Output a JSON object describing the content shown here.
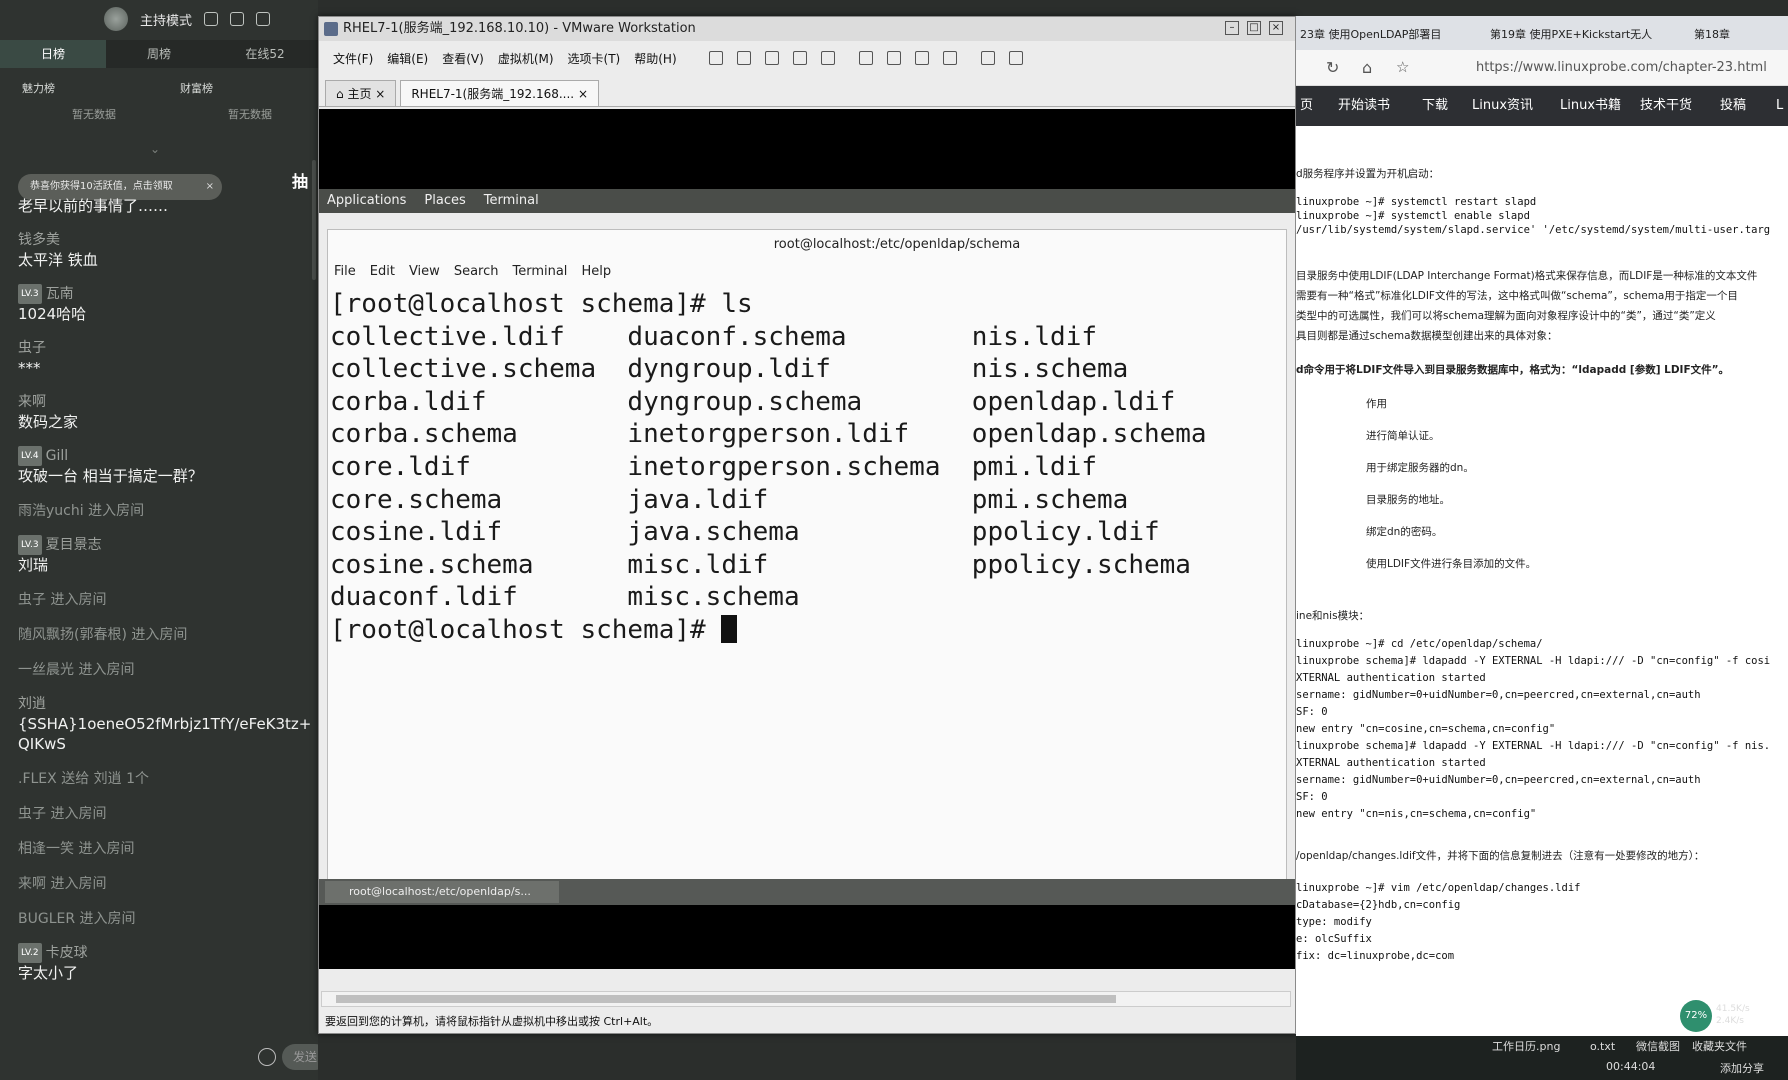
{
  "left_panel": {
    "mode_label": "主持模式",
    "rank_tabs": [
      "日榜",
      "周榜",
      "在线52"
    ],
    "charm_rank": "魅力榜",
    "wealth_rank": "财富榜",
    "charm_empty": "暂无数据",
    "wealth_empty": "暂无数据",
    "toast": "恭喜你获得10活跃值，点击领取",
    "peek_text": "抽",
    "chat": [
      {
        "user": "",
        "text": "老早以前的事情了……"
      },
      {
        "user": "钱多美",
        "text": "太平洋 铁血"
      },
      {
        "lv": "LV.3",
        "user": "瓦南",
        "text": "1024哈哈"
      },
      {
        "user": "虫子",
        "text": "***"
      },
      {
        "user": "来啊",
        "text": "数码之家"
      },
      {
        "lv": "LV.4",
        "user": "Gill",
        "text": "攻破一台 相当于搞定一群？"
      },
      {
        "sys": "雨浩yuchi 进入房间"
      },
      {
        "lv": "LV.3",
        "user": "夏目景志",
        "text": "刘瑞"
      },
      {
        "sys": "虫子 进入房间"
      },
      {
        "sys": "随风飘扬(郭春根) 进入房间"
      },
      {
        "sys": "一丝晨光 进入房间"
      },
      {
        "user": "刘逍",
        "text": "{SSHA}1oeneO52fMrbjz1TfY/eFeK3tz+QIKwS"
      },
      {
        "sys": ".FLEX 送给 刘逍 1个"
      },
      {
        "sys": "虫子 进入房间"
      },
      {
        "sys": "相逢一笑 进入房间"
      },
      {
        "sys": "来啊 进入房间"
      },
      {
        "sys": "BUGLER 进入房间"
      },
      {
        "lv": "LV.2",
        "user": "卡皮球",
        "text": "字太小了"
      }
    ],
    "send_label": "发送"
  },
  "vmware": {
    "title": "RHEL7-1(服务端_192.168.10.10) - VMware Workstation",
    "menu": [
      "文件(F)",
      "编辑(E)",
      "查看(V)",
      "虚拟机(M)",
      "选项卡(T)",
      "帮助(H)"
    ],
    "tabs": [
      "主页",
      "RHEL7-1(服务端_192.168...."
    ],
    "gnome": {
      "applications": "Applications",
      "places": "Places",
      "terminal": "Terminal"
    },
    "terminal": {
      "title": "root@localhost:/etc/openldap/schema",
      "menu": [
        "File",
        "Edit",
        "View",
        "Search",
        "Terminal",
        "Help"
      ],
      "lines": [
        "[root@localhost schema]# ls",
        "collective.ldif    duaconf.schema        nis.ldif",
        "collective.schema  dyngroup.ldif         nis.schema",
        "corba.ldif         dyngroup.schema       openldap.ldif",
        "corba.schema       inetorgperson.ldif    openldap.schema",
        "core.ldif          inetorgperson.schema  pmi.ldif",
        "core.schema        java.ldif             pmi.schema",
        "cosine.ldif        java.schema           ppolicy.ldif",
        "cosine.schema      misc.ldif             ppolicy.schema",
        "duaconf.ldif       misc.schema"
      ],
      "prompt": "[root@localhost schema]# "
    },
    "taskbar_item": "root@localhost:/etc/openldap/s...",
    "status": "要返回到您的计算机，请将鼠标指针从虚拟机中移出或按 Ctrl+Alt。"
  },
  "browser": {
    "tabs": [
      "23章 使用OpenLDAP部署目",
      "第19章 使用PXE+Kickstart无人",
      "第18章"
    ],
    "url": "https://www.linuxprobe.com/chapter-23.html",
    "nav": [
      "页",
      "开始读书",
      "下载",
      "Linux资讯",
      "Linux书籍",
      "技术干货",
      "投稿",
      "L"
    ],
    "content": {
      "p1": "d服务程序并设置为开机启动：",
      "code1": [
        "linuxprobe ~]# systemctl restart slapd",
        "linuxprobe ~]# systemctl enable slapd",
        "/usr/lib/systemd/system/slapd.service' '/etc/systemd/system/multi-user.targ"
      ],
      "p2": "目录服务中使用LDIF(LDAP Interchange Format)格式来保存信息，而LDIF是一种标准的文本文件",
      "p3": "需要有一种“格式”标准化LDIF文件的写法，这中格式叫做“schema”，schema用于指定一个目",
      "p4": "类型中的可选属性，我们可以将schema理解为面向对象程序设计中的“类”，通过“类”定义",
      "p5": "具目则都是通过schema数据模型创建出来的具体对象：",
      "p6": "d命令用于将LDIF文件导入到目录服务数据库中，格式为：“ldapadd [参数] LDIF文件”。",
      "table": [
        "作用",
        "进行简单认证。",
        "用于绑定服务器的dn。",
        "目录服务的地址。",
        "绑定dn的密码。",
        "使用LDIF文件进行条目添加的文件。"
      ],
      "p7": "ine和nis模块：",
      "code2": [
        "linuxprobe ~]# cd /etc/openldap/schema/",
        "linuxprobe schema]# ldapadd -Y EXTERNAL -H ldapi:/// -D \"cn=config\" -f cosi",
        "XTERNAL authentication started",
        "sername: gidNumber=0+uidNumber=0,cn=peercred,cn=external,cn=auth",
        "SF: 0",
        "new entry \"cn=cosine,cn=schema,cn=config\"",
        "linuxprobe schema]# ldapadd -Y EXTERNAL -H ldapi:/// -D \"cn=config\" -f nis.",
        "XTERNAL authentication started",
        "sername: gidNumber=0+uidNumber=0,cn=peercred,cn=external,cn=auth",
        "SF: 0",
        "new entry \"cn=nis,cn=schema,cn=config\""
      ],
      "p8": "/openldap/changes.ldif文件，并将下面的信息复制进去（注意有一处要修改的地方）：",
      "code3": [
        "linuxprobe ~]# vim /etc/openldap/changes.ldif",
        "cDatabase={2}hdb,cn=config",
        "type: modify",
        "e: olcSuffix",
        "fix: dc=linuxprobe,dc=com"
      ]
    }
  },
  "desktop": {
    "icon1": "工作日历.png",
    "icon2": "o.txt",
    "icon3": "微信截图",
    "icon4": "收藏夹文件",
    "cpu": "72%",
    "net_up": "41.5K/s",
    "net_down": "2.4K/s",
    "timer": "00:44:04",
    "share": "添加分享"
  }
}
